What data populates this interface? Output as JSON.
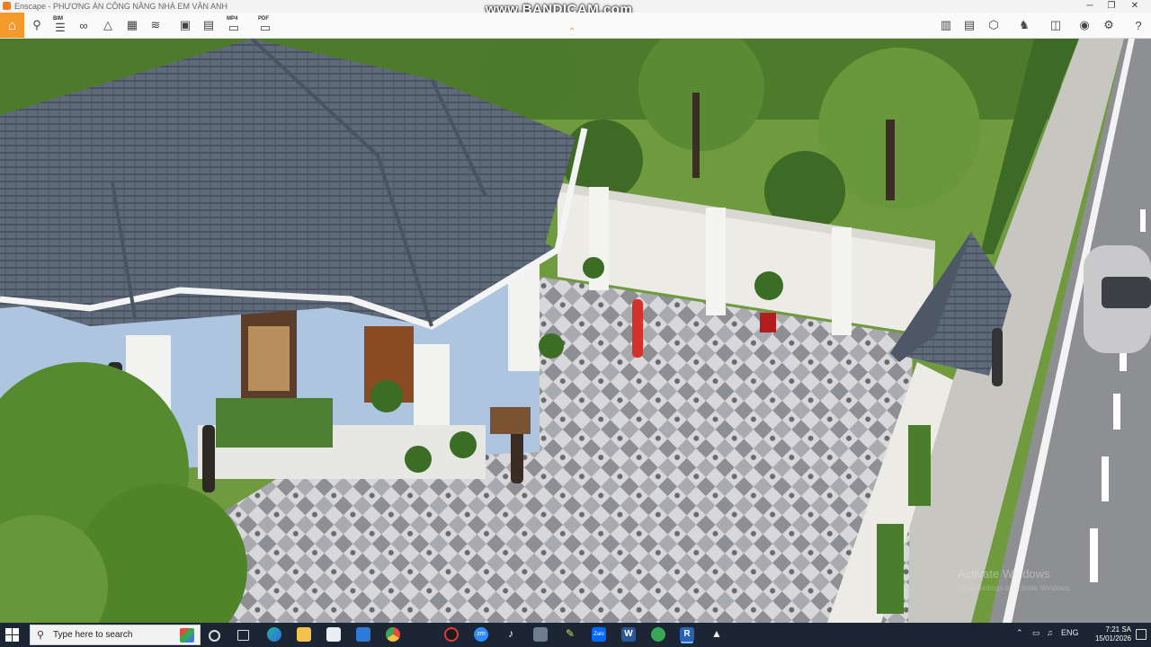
{
  "titlebar": {
    "app": "Enscape",
    "title": "Enscape - PHƯƠNG ÁN CÔNG NĂNG NHÀ EM VÂN ANH",
    "minimize": "─",
    "maximize": "❐",
    "close": "✕"
  },
  "watermark": "www.BANDICAM.com",
  "toolbar": {
    "left_tools": [
      "home-icon",
      "location-icon",
      "list-icon",
      "binoculars-icon",
      "triangle-icon",
      "building-icon",
      "layers-icon",
      "capture-icon",
      "batch-capture-icon",
      "video-icon",
      "export-icon"
    ],
    "bim_label": "BIM",
    "mp4_label": "MP4",
    "pdf_label": "PDF",
    "right_tools": [
      "map-icon",
      "panorama-icon",
      "asset-cube-icon",
      "walk-icon",
      "vr-headset-icon",
      "visual-settings-icon",
      "settings-gear-icon",
      "help-icon"
    ]
  },
  "scene": {
    "description_hidden": "",
    "windows_watermark": "Activate Windows",
    "windows_watermark_sub": "Go to Settings to activate Windows."
  },
  "taskbar": {
    "search_placeholder": "Type here to search",
    "apps": [
      "cortana-icon",
      "task-view-icon",
      "edge-icon",
      "file-explorer-icon",
      "store-icon",
      "mail-icon",
      "chrome-icon",
      "record-icon",
      "zoom-icon",
      "tiktok-icon",
      "calculator-icon",
      "sketchup-icon",
      "zalo-icon",
      "word-icon",
      "excel-icon",
      "revit-icon",
      "enscape-icon"
    ],
    "zoom_label": "zm",
    "zalo_label": "Zalo",
    "word_label": "W",
    "revit_label": "R",
    "lang": "ENG",
    "time": "7:21 SA",
    "date": "15/01/2026"
  },
  "colors": {
    "accent": "#f39a2a",
    "taskbar": "#1b2534",
    "roof": "#5d6878",
    "wall": "#f1f1ee"
  }
}
